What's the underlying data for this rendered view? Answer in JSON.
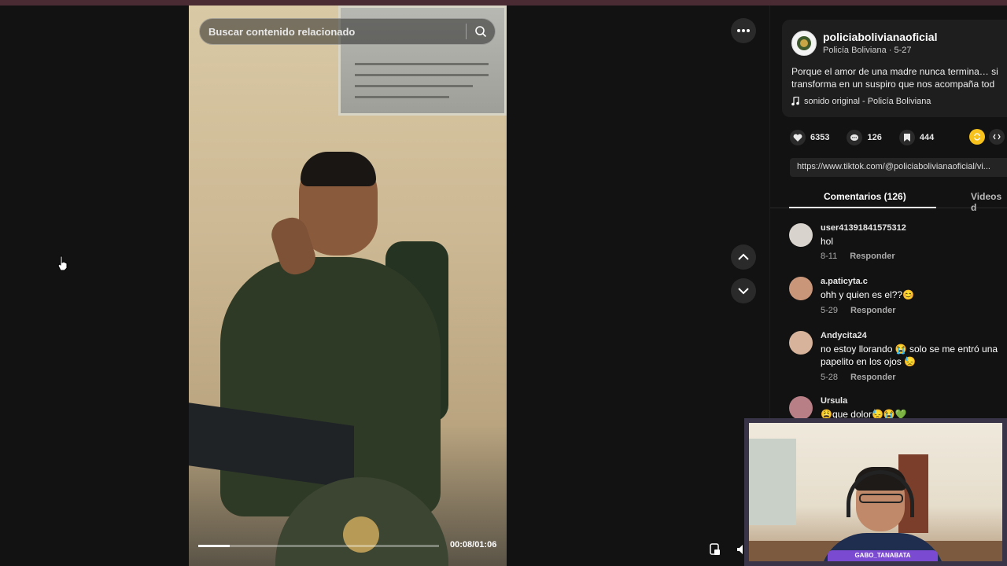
{
  "search": {
    "placeholder": "Buscar contenido relacionado"
  },
  "player": {
    "time": "00:08/01:06",
    "progress": 0.13
  },
  "post": {
    "author": "policiabolivianaoficial",
    "author_name": "Policía Boliviana",
    "date": "5-27",
    "description_line1": "Porque el amor de una madre nunca termina… si",
    "description_line2": "transforma en un suspiro que nos acompaña tod",
    "music": "sonido original - Policía Boliviana",
    "likes": "6353",
    "comments": "126",
    "saves": "444",
    "link": "https://www.tiktok.com/@policiabolivianaoficial/vi..."
  },
  "tabs": {
    "comments_label": "Comentarios (126)",
    "videos_label": "Videos d"
  },
  "comments": [
    {
      "user": "user41391841575312",
      "text": "hol",
      "date": "8-11",
      "reply": "Responder"
    },
    {
      "user": "a.paticyta.c",
      "text": "ohh y quien es el??😊",
      "date": "5-29",
      "reply": "Responder"
    },
    {
      "user": "Andycita24",
      "text": "no estoy llorando 😭 solo se me entró una",
      "text2": "papelito en los ojos 😓",
      "date": "5-28",
      "reply": "Responder"
    },
    {
      "user": "Ursula",
      "text": "😩que dolor😓😭💚"
    }
  ],
  "webcam": {
    "label": "GABO_TANABATA"
  }
}
